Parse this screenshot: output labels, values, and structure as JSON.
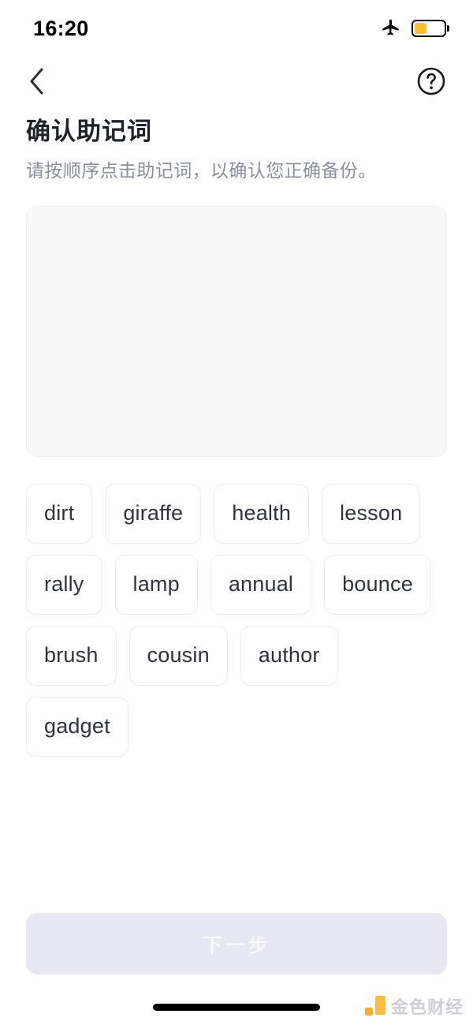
{
  "status_bar": {
    "time": "16:20",
    "airplane_icon": "airplane-mode-icon",
    "battery_icon": "battery-icon",
    "battery_level_percent": 42,
    "battery_fill_color": "#fbc02d"
  },
  "nav": {
    "back_icon": "chevron-left-icon",
    "help_icon": "question-mark-circle-icon"
  },
  "header": {
    "title": "确认助记词",
    "subtitle": "请按顺序点击助记词，以确认您正确备份。"
  },
  "answer_panel": {
    "selected_words": [],
    "background_color": "#f8f8f9"
  },
  "word_pool": {
    "words": [
      "dirt",
      "giraffe",
      "health",
      "lesson",
      "rally",
      "lamp",
      "annual",
      "bounce",
      "brush",
      "cousin",
      "author",
      "gadget"
    ]
  },
  "footer": {
    "next_label": "下一步",
    "next_enabled": false,
    "next_background_color": "#e8e8f4",
    "next_text_color": "#fbfbfe"
  },
  "watermark": {
    "text": "金色财经",
    "logo_color": "#f5a623",
    "logo_color_alt": "#f7b733"
  }
}
